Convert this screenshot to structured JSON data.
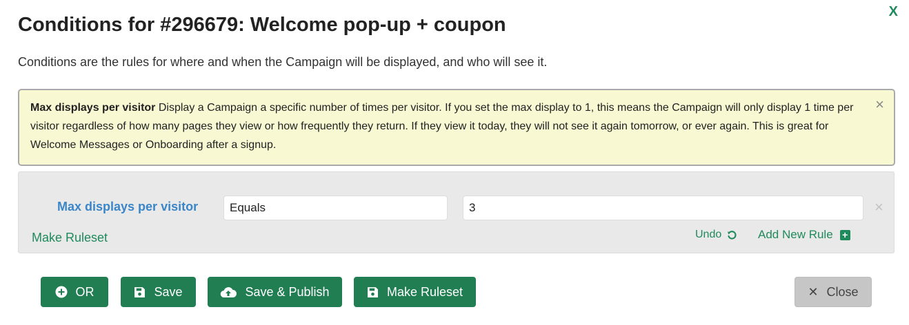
{
  "dialog": {
    "close_x": "X",
    "title": "Conditions for #296679: Welcome pop-up + coupon",
    "intro": "Conditions are the rules for where and when the Campaign will be displayed, and who will see it."
  },
  "alert": {
    "heading": "Max displays per visitor",
    "body": "Display a Campaign a specific number of times per visitor. If you set the max display to 1, this means the Campaign will only display 1 time per visitor regardless of how many pages they view or how frequently they return. If they view it today, they will not see it again tomorrow, or ever again. This is great for Welcome Messages or Onboarding after a signup.",
    "close_glyph": "×"
  },
  "rule": {
    "label": "Max displays per visitor",
    "operator": "Equals",
    "value": "3",
    "remove_glyph": "×"
  },
  "rules_panel": {
    "make_ruleset": "Make Ruleset",
    "undo": "Undo",
    "add_new_rule": "Add New Rule",
    "add_icon_glyph": "+"
  },
  "buttons": {
    "or": "OR",
    "save": "Save",
    "save_publish": "Save & Publish",
    "make_ruleset": "Make Ruleset",
    "close": "Close",
    "close_glyph": "✕"
  },
  "icons": {
    "or": "plus-circle-icon",
    "save": "floppy-disk-icon",
    "save_publish": "cloud-upload-icon",
    "make_ruleset": "floppy-disk-icon",
    "close": "times-icon",
    "undo": "undo-icon",
    "add": "plus-square-icon"
  },
  "colors": {
    "primary_green": "#217d52",
    "link_green": "#1f8a5b",
    "rule_label_blue": "#3a86c8",
    "alert_bg": "#f8f8d2",
    "close_button_bg": "#c6c6c6"
  }
}
